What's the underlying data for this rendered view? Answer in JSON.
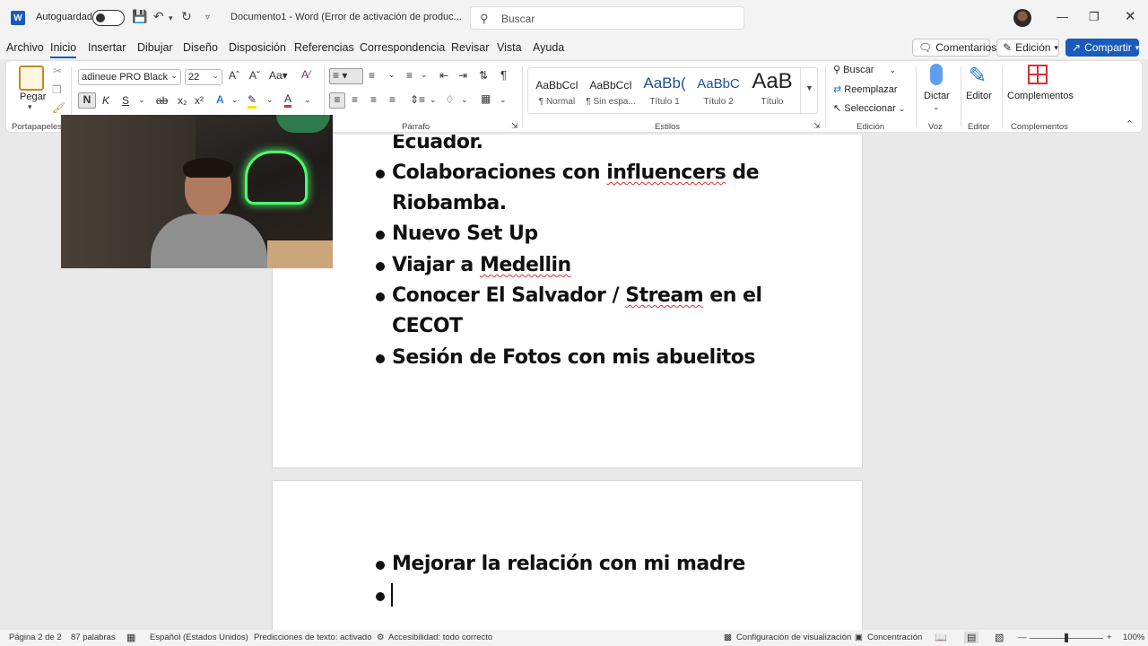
{
  "titlebar": {
    "autosave_label": "Autoguardado",
    "doc_title": "Documento1  -  Word (Error de activación de produc...",
    "search_placeholder": "Buscar"
  },
  "menu": {
    "items": [
      "Archivo",
      "Inicio",
      "Insertar",
      "Dibujar",
      "Diseño",
      "Disposición",
      "Referencias",
      "Correspondencia",
      "Revisar",
      "Vista",
      "Ayuda"
    ],
    "comments_label": "Comentarios",
    "editing_label": "Edición",
    "share_label": "Compartir"
  },
  "ribbon": {
    "paste_label": "Pegar",
    "font_name": "adineue PRO Black",
    "font_size": "22",
    "bold_label": "N",
    "italic_label": "K",
    "underline_label": "S",
    "groups": {
      "clipboard": "Portapapeles",
      "paragraph": "Párrafo",
      "styles": "Estilos",
      "editing": "Edición",
      "voice": "Voz",
      "editor": "Editor",
      "addins": "Complementos"
    },
    "styles": [
      {
        "preview": "AaBbCcI",
        "name": "¶ Normal"
      },
      {
        "preview": "AaBbCcI",
        "name": "¶ Sin espa..."
      },
      {
        "preview": "AaBb(",
        "name": "Título 1"
      },
      {
        "preview": "AaBbC",
        "name": "Título 2"
      },
      {
        "preview": "AaB",
        "name": "Título"
      }
    ],
    "find_label": "Buscar",
    "replace_label": "Reemplazar",
    "select_label": "Seleccionar",
    "dictate_label": "Dictar",
    "editor_label": "Editor",
    "addins_label": "Complementos"
  },
  "document": {
    "page1_lines": [
      {
        "text": "Ecuador.",
        "bullet": false
      },
      {
        "pre": "Colaboraciones con ",
        "squig": "influencers",
        "post": " de",
        "bullet": true
      },
      {
        "text": "Riobamba.",
        "bullet": false
      },
      {
        "text": "Nuevo Set Up",
        "bullet": true
      },
      {
        "pre": "Viajar a ",
        "squig": "Medellin",
        "post": "",
        "bullet": true
      },
      {
        "pre": "Conocer El Salvador / ",
        "squig": "Stream",
        "post": " en el",
        "bullet": true
      },
      {
        "text": "CECOT",
        "bullet": false
      },
      {
        "text": "Sesión de Fotos con mis abuelitos",
        "bullet": true
      }
    ],
    "page2_lines": [
      {
        "text": "Mejorar la relación con mi madre",
        "bullet": true
      },
      {
        "text": "",
        "bullet": true
      }
    ]
  },
  "status": {
    "page": "Página 2 de 2",
    "words": "87 palabras",
    "language": "Español (Estados Unidos)",
    "predictions": "Predicciones de texto: activado",
    "accessibility": "Accesibilidad: todo correcto",
    "display_settings": "Configuración de visualización",
    "focus": "Concentración",
    "zoom": "100%"
  }
}
